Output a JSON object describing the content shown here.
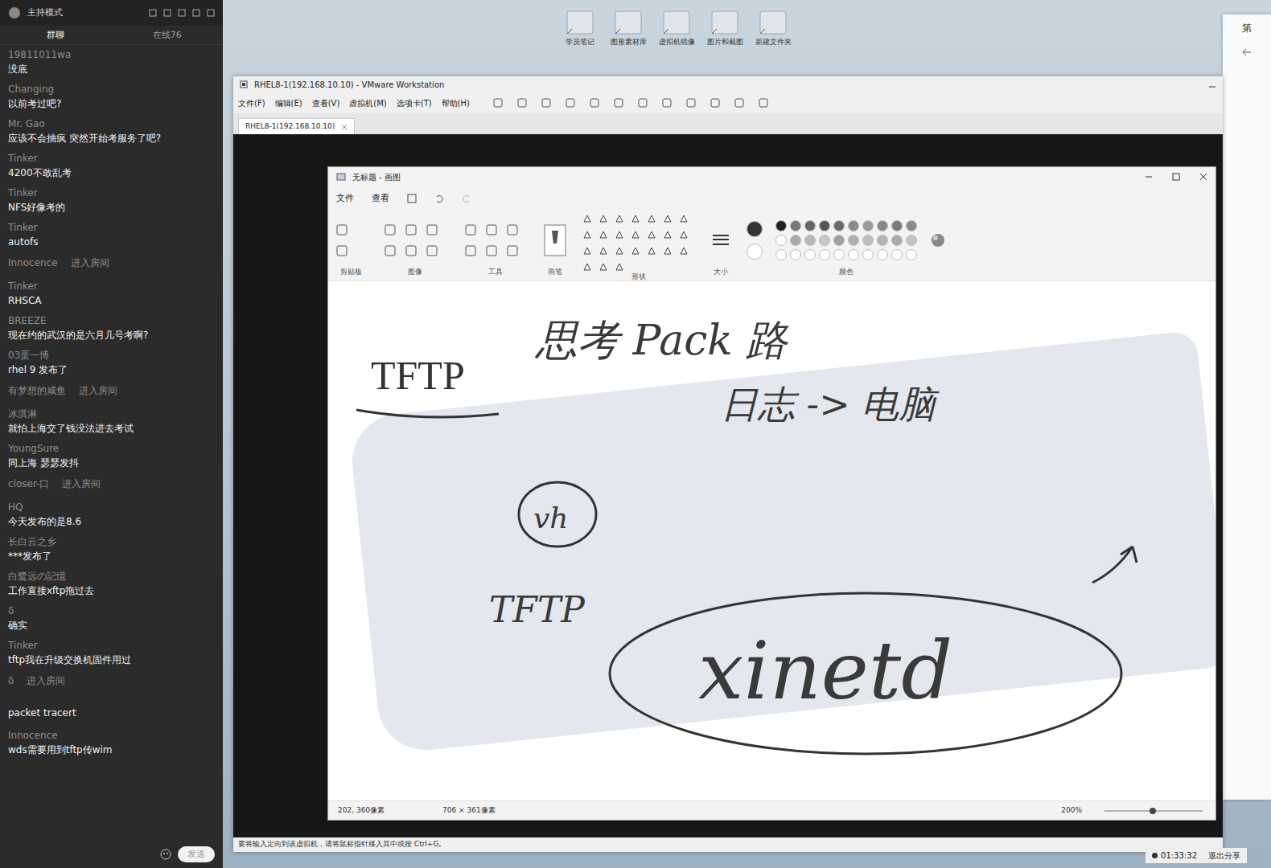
{
  "chat": {
    "title": "主持模式",
    "tabs": [
      {
        "label": "群聊",
        "selected": true
      },
      {
        "label": "在线76",
        "selected": false
      }
    ],
    "messages": [
      {
        "kind": "message",
        "name": "19811011wa",
        "text": "没底"
      },
      {
        "kind": "message",
        "name": "Changing",
        "text": "以前考过吧?"
      },
      {
        "kind": "message",
        "name": "Mr. Gao",
        "text": "应该不会抽疯 突然开始考服务了吧?"
      },
      {
        "kind": "message",
        "name": "Tinker",
        "text": "4200不敢乱考"
      },
      {
        "kind": "message",
        "name": "Tinker",
        "text": "NFS好像考的"
      },
      {
        "kind": "message",
        "name": "Tinker",
        "text": "autofs"
      },
      {
        "kind": "join",
        "name": "Innocence",
        "text": "进入房间"
      },
      {
        "kind": "message",
        "name": "Tinker",
        "text": "RHSCA"
      },
      {
        "kind": "message",
        "name": "BREEZE",
        "text": "现在约的武汉的是六月几号考啊?"
      },
      {
        "kind": "message",
        "name": "03蛋一博",
        "text": "rhel 9 发布了"
      },
      {
        "kind": "join",
        "name": "有梦想的咸鱼",
        "text": "进入房间"
      },
      {
        "kind": "message",
        "name": "冰淇淋",
        "text": "就怕上海交了钱没法进去考试"
      },
      {
        "kind": "message",
        "name": "YoungSure",
        "text": "同上海 瑟瑟发抖"
      },
      {
        "kind": "join",
        "name": "closer-口",
        "text": "进入房间"
      },
      {
        "kind": "message",
        "name": "HQ",
        "text": "今天发布的是8.6"
      },
      {
        "kind": "message",
        "name": "长白云之乡",
        "text": "***发布了"
      },
      {
        "kind": "message",
        "name": "白鹭远の記憶",
        "text": "工作直接xftp拖过去"
      },
      {
        "kind": "message",
        "name": "δ",
        "text": "确实"
      },
      {
        "kind": "message",
        "name": "Tinker",
        "text": "tftp我在升级交换机固件用过"
      },
      {
        "kind": "join",
        "name": "δ",
        "text": "进入房间"
      },
      {
        "kind": "plain",
        "text": "packet tracert"
      },
      {
        "kind": "message",
        "name": "Innocence",
        "text": "wds需要用到tftp传wim"
      }
    ],
    "send": "发送"
  },
  "desktop": {
    "icons": [
      "学员笔记",
      "图形素材库",
      "虚拟机镜像",
      "图片和截图",
      "新建文件夹"
    ]
  },
  "vmware": {
    "title": "RHEL8-1(192.168.10.10) - VMware Workstation",
    "menu": [
      "文件(F)",
      "编辑(E)",
      "查看(V)",
      "虚拟机(M)",
      "选项卡(T)",
      "帮助(H)"
    ],
    "tab": "RHEL8-1(192.168.10.10)",
    "status": "要将输入定向到该虚拟机，请将鼠标指针移入其中或按 Ctrl+G。"
  },
  "paint": {
    "title": "无标题 - 画图",
    "menu": [
      "文件",
      "查看"
    ],
    "groups": [
      "剪贴板",
      "图像",
      "工具",
      "画笔",
      "形状",
      "大小",
      "颜色"
    ],
    "current_colors": [
      "#333333",
      "#ffffff"
    ],
    "palette": [
      "#222222",
      "#777777",
      "#666666",
      "#555555",
      "#6a6a6a",
      "#8a8a8a",
      "#9a9a9a",
      "#888888",
      "#7a7a7a",
      "#8c8c8c",
      "#ffffff",
      "#a8a8a8",
      "#b8b8b8",
      "#c8c8c8",
      "#a0a0a0",
      "#b0b0b0",
      "#c0c0c0",
      "#b4b4b4",
      "#aaaaaa",
      "#c4c4c4",
      "#ffffff",
      "#ffffff",
      "#ffffff",
      "#ffffff",
      "#ffffff",
      "#ffffff",
      "#ffffff",
      "#ffffff",
      "#ffffff",
      "#ffffff"
    ],
    "notes": [
      {
        "kind": "typed",
        "text": "TFTP"
      },
      {
        "kind": "hand",
        "text": "思考 Pack 路"
      },
      {
        "kind": "hand",
        "text": "日志 -> 电脑"
      },
      {
        "kind": "hand",
        "text": "vh"
      },
      {
        "kind": "hand",
        "text": "TFTP"
      },
      {
        "kind": "hand",
        "text": "xinetd"
      }
    ],
    "status": {
      "cursor": "202, 360像素",
      "size": "706 × 361像素",
      "zoom": "200%"
    }
  },
  "edge_window": {
    "label": "第"
  },
  "share_bar": {
    "time": "01:33:32",
    "action": "退出分享"
  }
}
